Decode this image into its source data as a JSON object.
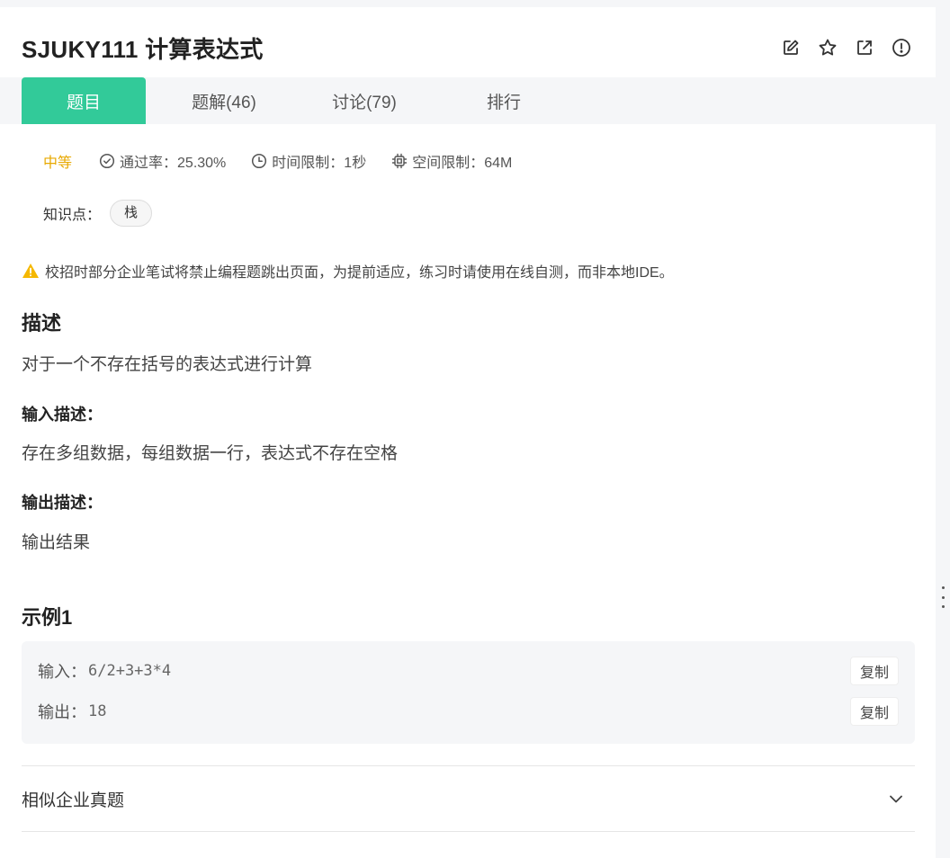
{
  "problem": {
    "title": "SJUKY111  计算表达式"
  },
  "header": {
    "icons": [
      "edit-icon",
      "star-icon",
      "share-icon",
      "report-icon"
    ]
  },
  "tabs": [
    {
      "label": "题目",
      "active": true
    },
    {
      "label": "题解(46)",
      "active": false
    },
    {
      "label": "讨论(79)",
      "active": false
    },
    {
      "label": "排行",
      "active": false
    }
  ],
  "meta": {
    "difficulty": "中等",
    "pass_rate": "通过率：25.30%",
    "time_limit": "时间限制：1秒",
    "memory_limit": "空间限制：64M"
  },
  "knowledge": {
    "label": "知识点：",
    "tags": [
      "栈"
    ]
  },
  "warning": "校招时部分企业笔试将禁止编程题跳出页面，为提前适应，练习时请使用在线自测，而非本地IDE。",
  "description": {
    "heading": "描述",
    "text": "对于一个不存在括号的表达式进行计算"
  },
  "input_desc": {
    "heading": "输入描述：",
    "text": "存在多组数据，每组数据一行，表达式不存在空格"
  },
  "output_desc": {
    "heading": "输出描述：",
    "text": "输出结果"
  },
  "example": {
    "heading": "示例1",
    "input_label": "输入：",
    "input_value": "6/2+3+3*4",
    "output_label": "输出：",
    "output_value": "18",
    "copy_label": "复制"
  },
  "similar": {
    "label": "相似企业真题"
  },
  "colors": {
    "accent": "#32ca99",
    "difficulty": "#e8a900",
    "warning": "#f5b800"
  }
}
